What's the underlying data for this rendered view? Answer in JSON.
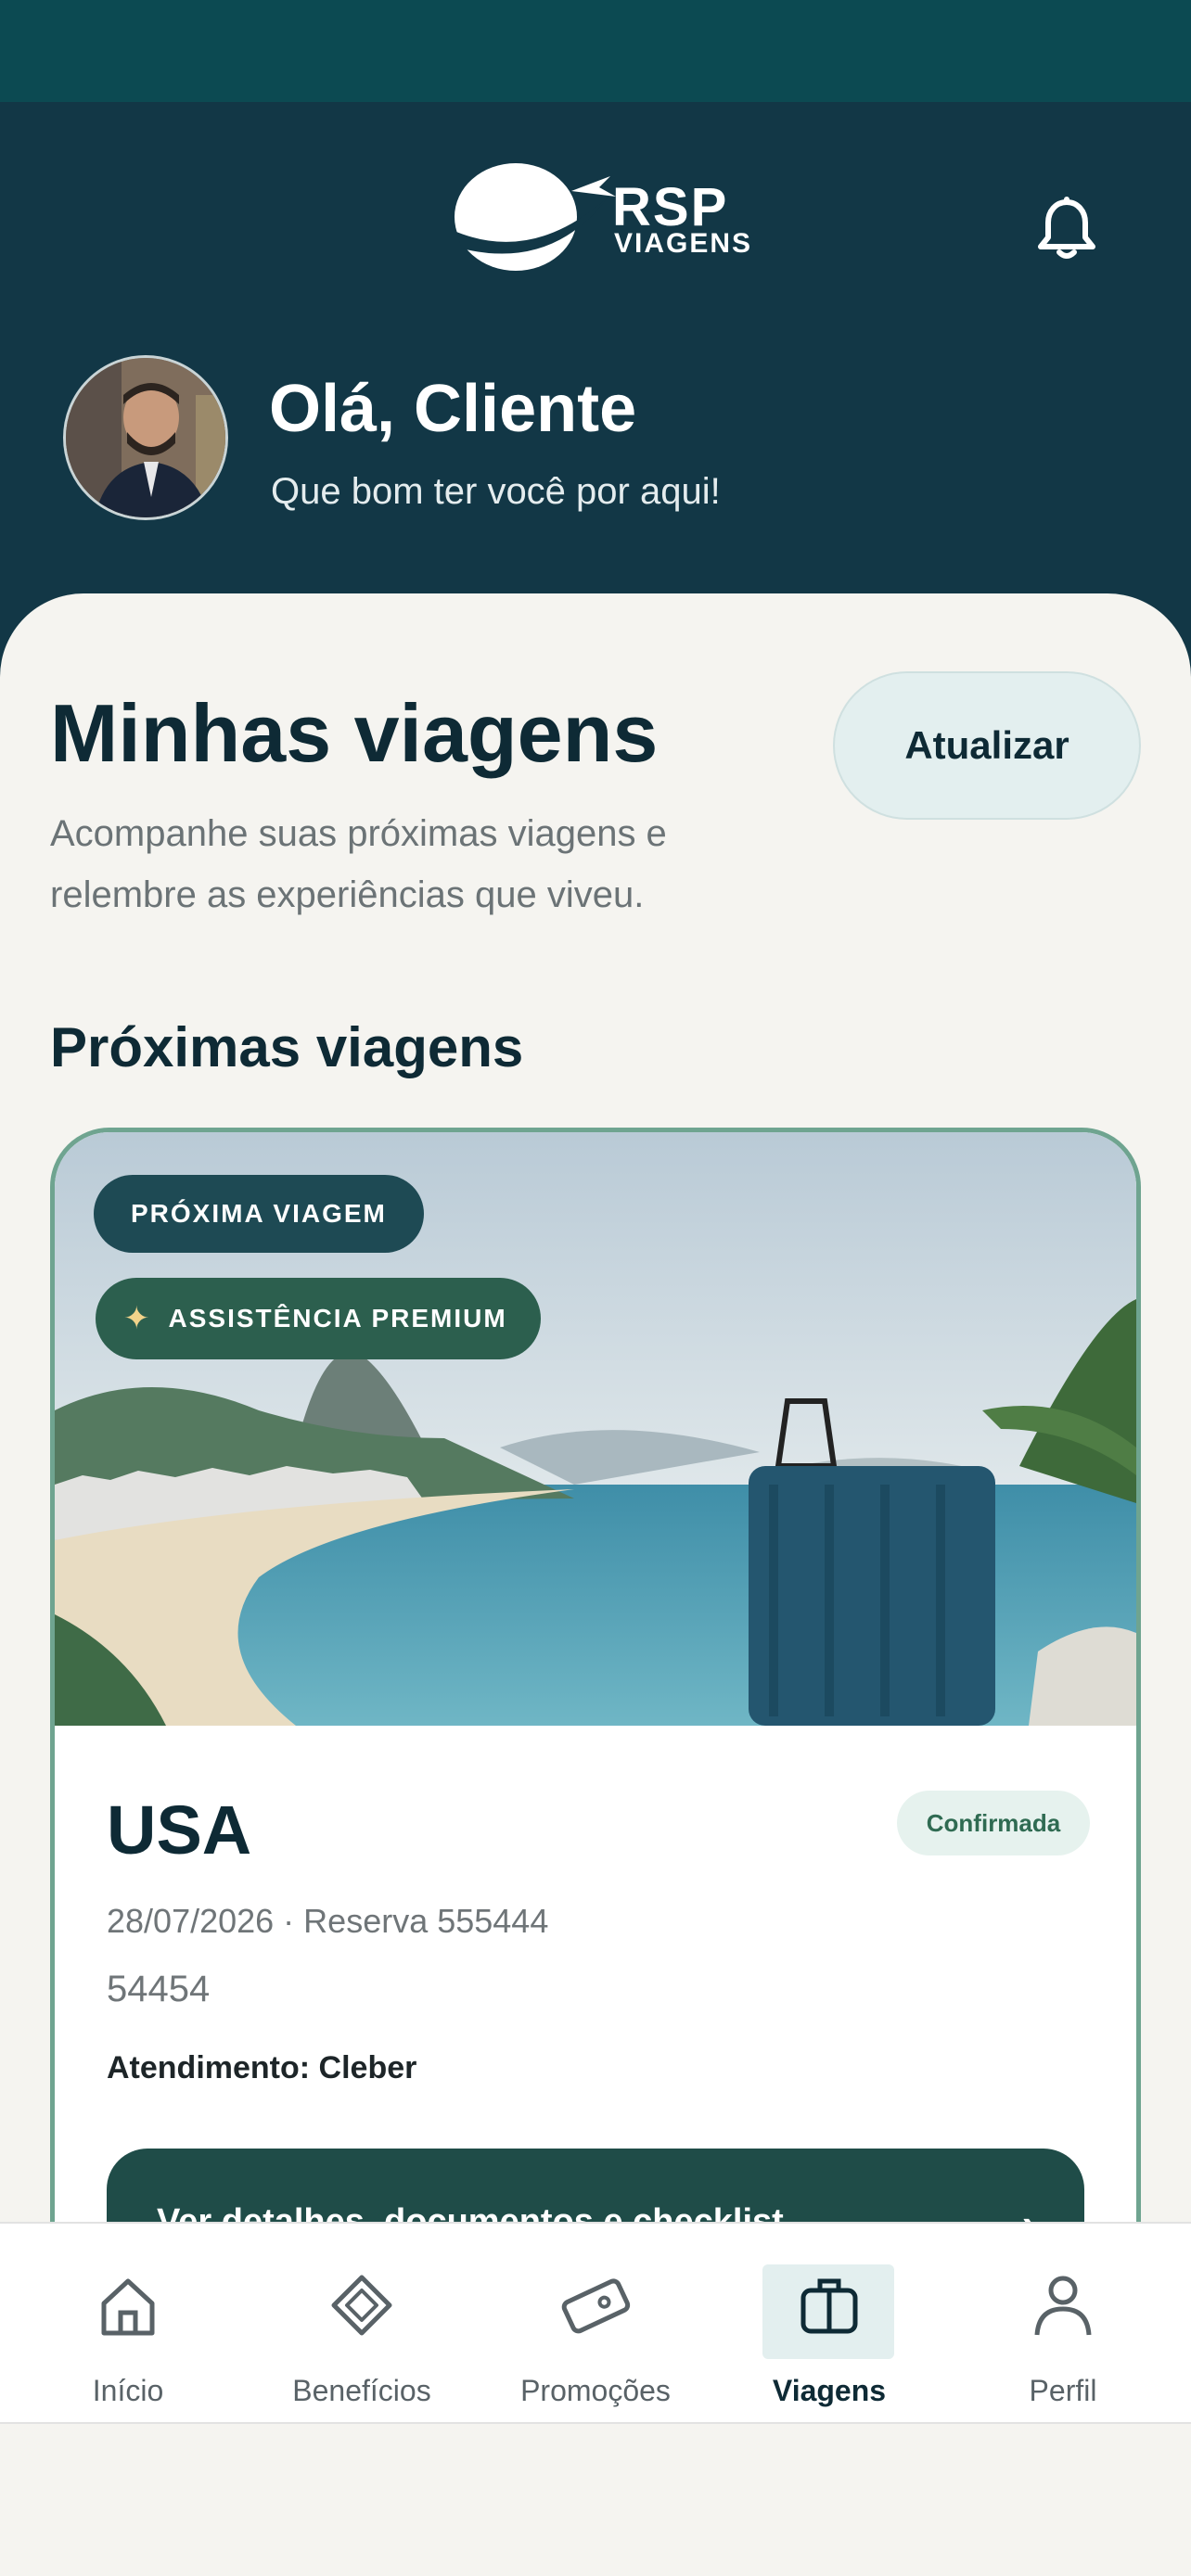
{
  "app": {
    "brand_name": "RSP",
    "brand_sub": "VIAGENS"
  },
  "header": {
    "greeting": "Olá, Cliente",
    "subtitle": "Que bom ter você por aqui!",
    "notification_icon": "bell-icon"
  },
  "main": {
    "title": "Minhas viagens",
    "refresh_label": "Atualizar",
    "description": "Acompanhe suas próximas viagens e relembre as experiências que viveu.",
    "section_title": "Próximas viagens"
  },
  "trip_card": {
    "tag_next": "PRÓXIMA VIAGEM",
    "tag_premium": "ASSISTÊNCIA PREMIUM",
    "destination": "USA",
    "status": "Confirmada",
    "meta": "28/07/2026 · Reserva 555444",
    "code": "54454",
    "agent": "Atendimento: Cleber",
    "details_label": "Ver detalhes, documentos e checklist",
    "details_arrow": "›"
  },
  "bottom_nav": {
    "items": [
      {
        "label": "Início",
        "icon": "home-icon"
      },
      {
        "label": "Benefícios",
        "icon": "diamond-icon"
      },
      {
        "label": "Promoções",
        "icon": "ticket-icon"
      },
      {
        "label": "Viagens",
        "icon": "suitcase-icon"
      },
      {
        "label": "Perfil",
        "icon": "user-icon"
      }
    ],
    "active": "Viagens"
  },
  "colors": {
    "header_bg": "#123746",
    "status_bar": "#0c4a52",
    "accent_green": "#1f4c48",
    "card_border": "#6fa490",
    "page_bg": "#f5f4f0"
  }
}
